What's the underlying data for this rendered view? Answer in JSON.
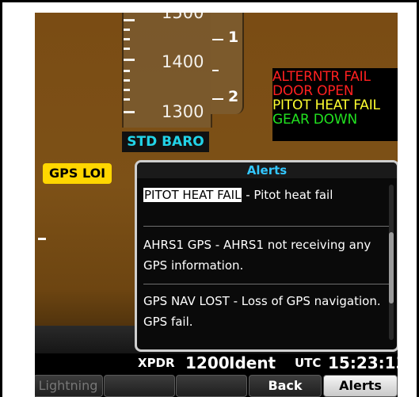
{
  "altitude": {
    "tape_values": [
      "1500",
      "1400",
      "1300"
    ]
  },
  "vsi": {
    "marks": [
      "1",
      "2"
    ]
  },
  "baro": {
    "label": "STD BARO"
  },
  "annunciations": [
    {
      "text": "ALTERNTR FAIL",
      "color": "#ff2020"
    },
    {
      "text": "DOOR OPEN",
      "color": "#ff2020"
    },
    {
      "text": "PITOT HEAT FAIL",
      "color": "#ffff30"
    },
    {
      "text": "GEAR DOWN",
      "color": "#22e020"
    }
  ],
  "gps_flag": "GPS LOI",
  "alerts_window": {
    "title": "Alerts",
    "items": [
      {
        "code": "PITOT HEAT FAIL",
        "message": "- Pitot heat fail",
        "highlighted": true
      },
      {
        "code": "AHRS1 GPS",
        "message": "- AHRS1 not receiving any GPS information.",
        "highlighted": false
      },
      {
        "code": "GPS NAV LOST",
        "message": "- Loss of GPS navigation. GPS fail.",
        "highlighted": false
      }
    ]
  },
  "status_bar": {
    "xpdr_label": "XPDR",
    "xpdr_code": "1200",
    "xpdr_mode": "Ident",
    "utc_label": "UTC",
    "utc_time": "15:23:13"
  },
  "softkeys": [
    {
      "label": "Lightning",
      "state": "disabled"
    },
    {
      "label": "",
      "state": "disabled"
    },
    {
      "label": "",
      "state": "disabled"
    },
    {
      "label": "Back",
      "state": "active"
    },
    {
      "label": "Alerts",
      "state": "selected"
    }
  ]
}
